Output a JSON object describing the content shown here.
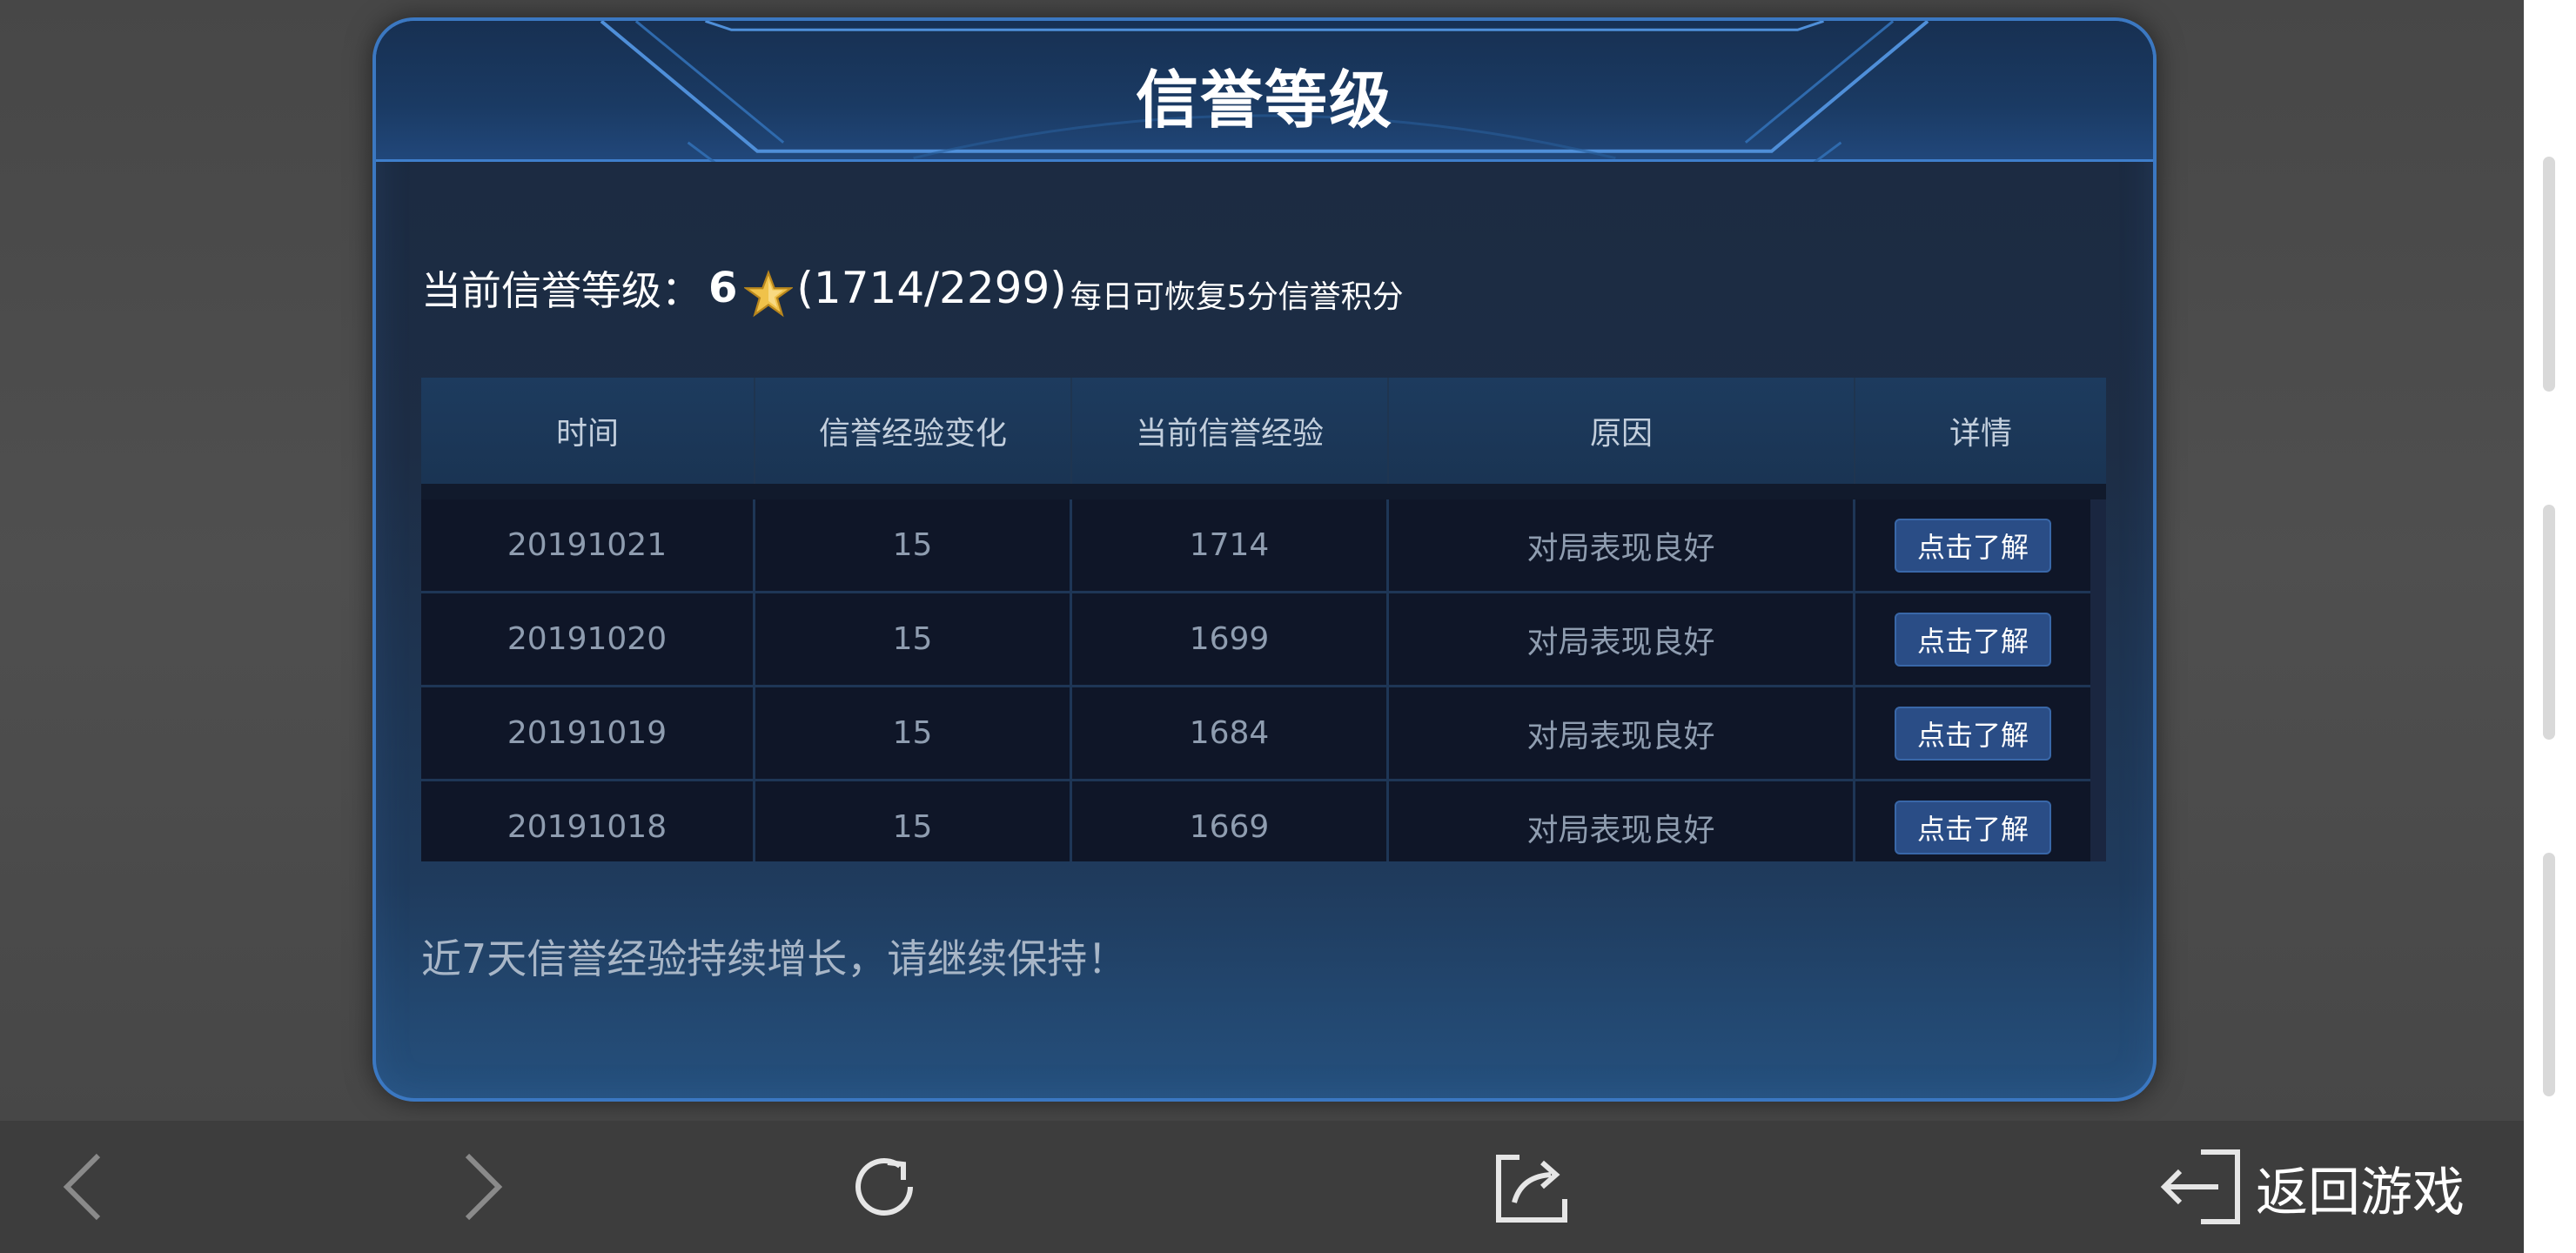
{
  "panel": {
    "title": "信誉等级",
    "level_label": "当前信誉等级：",
    "level_value": "6",
    "level_icon": "star-icon",
    "level_progress": "(1714/2299)",
    "level_note": "每日可恢复5分信誉积分"
  },
  "table": {
    "headers": [
      "时间",
      "信誉经验变化",
      "当前信誉经验",
      "原因",
      "详情"
    ],
    "rows": [
      {
        "date": "20191021",
        "change": "15",
        "current": "1714",
        "reason": "对局表现良好",
        "action": "点击了解"
      },
      {
        "date": "20191020",
        "change": "15",
        "current": "1699",
        "reason": "对局表现良好",
        "action": "点击了解"
      },
      {
        "date": "20191019",
        "change": "15",
        "current": "1684",
        "reason": "对局表现良好",
        "action": "点击了解"
      },
      {
        "date": "20191018",
        "change": "15",
        "current": "1669",
        "reason": "对局表现良好",
        "action": "点击了解"
      }
    ]
  },
  "footer_note": "近7天信誉经验持续增长，请继续保持！",
  "bottom_bar": {
    "back_icon": "chevron-left-icon",
    "forward_icon": "chevron-right-icon",
    "refresh_icon": "refresh-icon",
    "share_icon": "share-icon",
    "return_icon": "exit-icon",
    "return_label": "返回游戏"
  },
  "colors": {
    "panel_border": "#3b78c2",
    "button_bg": "#2a4d86",
    "bar_bg": "#3d3d3d"
  }
}
